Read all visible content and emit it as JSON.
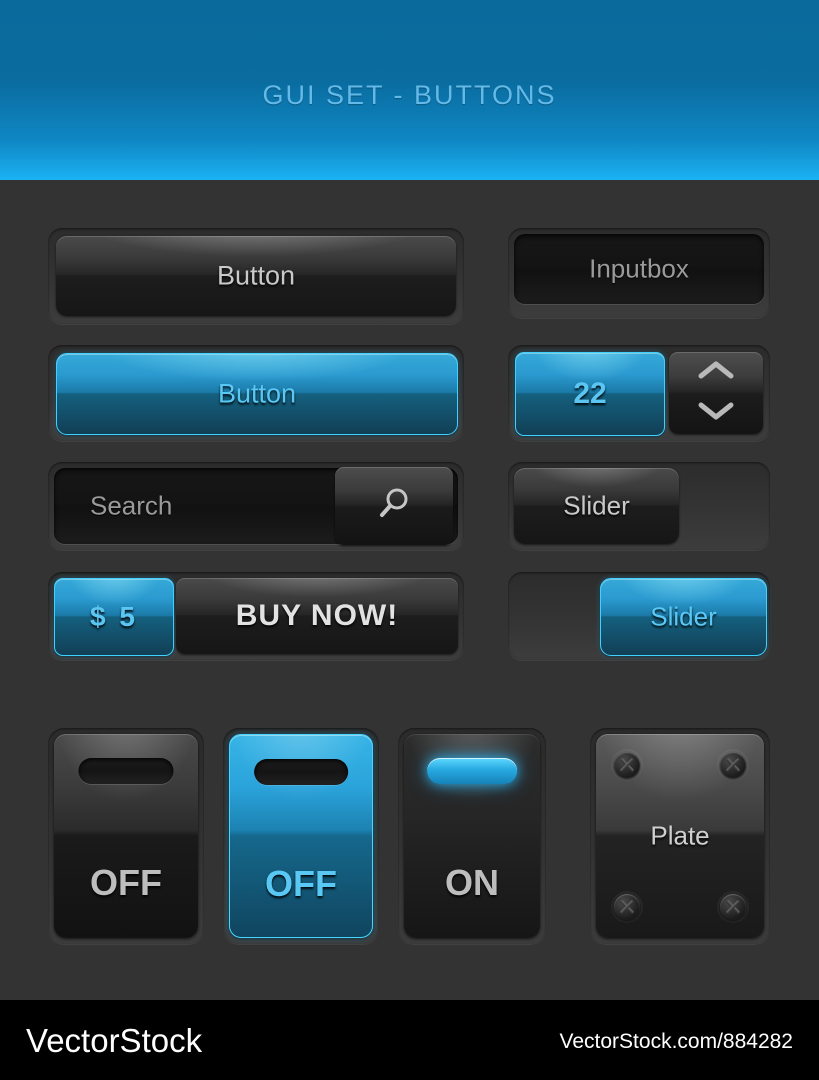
{
  "header": {
    "title": "GUI SET - BUTTONS",
    "bg_color_top": "#0b6a9c",
    "bg_color_bottom": "#1ab3f5",
    "title_color": "#63b9e8"
  },
  "accent": {
    "blue": "#2aa3da",
    "blue_light": "#59c8f5",
    "border_cyan": "#46d6ff",
    "dark_bg": "#333333",
    "text_gray": "#c9c9c9"
  },
  "components": {
    "button_dark": {
      "label": "Button"
    },
    "button_blue": {
      "label": "Button"
    },
    "inputbox": {
      "placeholder": "Inputbox",
      "value": ""
    },
    "spinner": {
      "value": "22",
      "up_icon": "chevron-up-icon",
      "down_icon": "chevron-down-icon"
    },
    "search": {
      "placeholder": "Search",
      "value": "",
      "icon": "magnifier-icon"
    },
    "slider_off": {
      "label": "Slider",
      "state": "off"
    },
    "slider_on": {
      "label": "Slider",
      "state": "on"
    },
    "buy": {
      "price": "$ 5",
      "label": "BUY NOW!"
    },
    "switch_off_dark": {
      "label": "OFF",
      "state": "off"
    },
    "switch_off_blue": {
      "label": "OFF",
      "state": "off"
    },
    "switch_on": {
      "label": "ON",
      "state": "on"
    },
    "plate": {
      "label": "Plate",
      "screws": [
        "screw-top-left",
        "screw-top-right",
        "screw-bottom-left",
        "screw-bottom-right"
      ]
    }
  },
  "footer": {
    "brand": "VectorStock",
    "url": "VectorStock.com/884282"
  }
}
